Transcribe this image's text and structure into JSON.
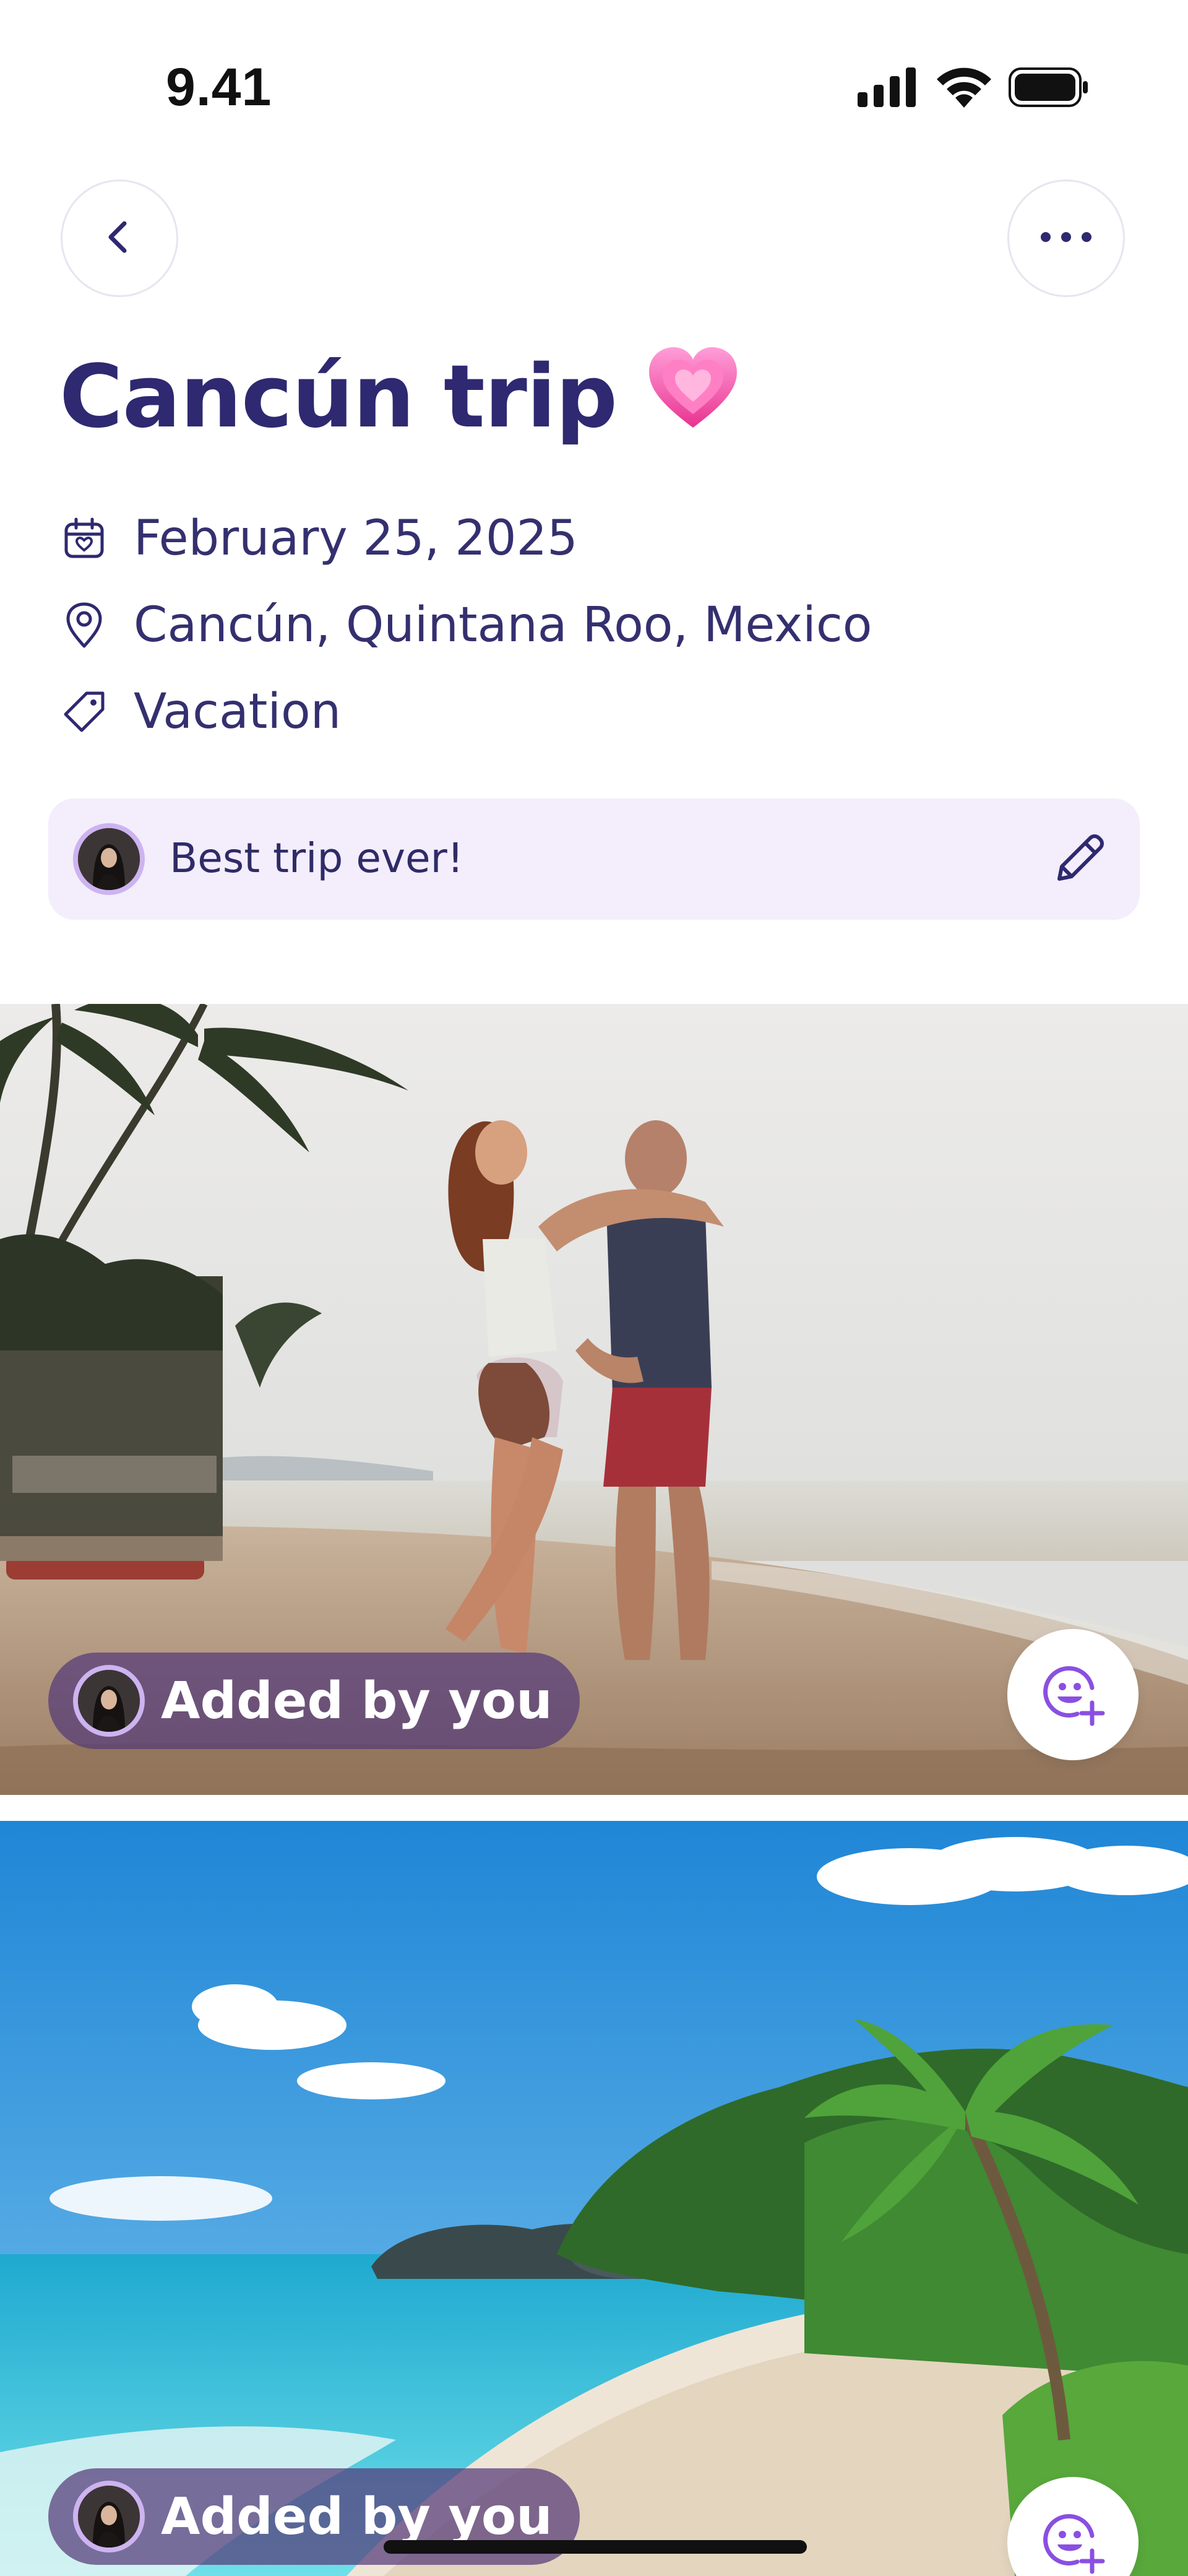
{
  "status_bar": {
    "time": "9.41",
    "icons": [
      "cellular-signal-icon",
      "wifi-icon",
      "battery-icon"
    ]
  },
  "nav": {
    "back_icon": "chevron-left-icon",
    "more_icon": "more-horizontal-icon"
  },
  "trip": {
    "title": "Cancún trip",
    "title_emoji": "growing-heart-emoji",
    "date": "February 25, 2025",
    "location": "Cancún, Quintana Roo, Mexico",
    "tag": "Vacation"
  },
  "note": {
    "text": "Best trip ever!",
    "edit_icon": "pencil-icon"
  },
  "photos": [
    {
      "scene": "couple embracing on a beach with palm trees",
      "added_by_label": "Added by you",
      "react_icon": "add-reaction-icon"
    },
    {
      "scene": "tropical beach with turquoise water and palm tree",
      "added_by_label": "Added by you",
      "react_icon": "add-reaction-icon"
    }
  ],
  "colors": {
    "title": "#2e2970",
    "text": "#34306f",
    "note_background": "#f3edfc",
    "accent_purple": "#8a4fe0",
    "avatar_ring": "#cdb3f0",
    "badge_background": "#543a78"
  }
}
